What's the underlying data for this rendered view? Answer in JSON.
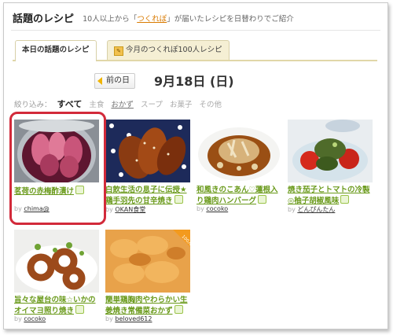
{
  "header": {
    "title": "話題のレシピ",
    "subtitle_before": "10人以上から「",
    "subtitle_link": "つくれぽ",
    "subtitle_after": "」が届いたレシピを日替わりでご紹介"
  },
  "tabs": [
    {
      "label": "本日の話題のレシピ",
      "active": true
    },
    {
      "label": "今月のつくれぽ100人レシピ",
      "active": false,
      "icon": "report-badge-icon"
    }
  ],
  "date_nav": {
    "prev_label": "前の日",
    "date": "9月18日 (日)"
  },
  "filter": {
    "label": "絞り込み：",
    "options": [
      "すべて",
      "主食",
      "おかず",
      "スープ",
      "お菓子",
      "その他"
    ],
    "selected": "すべて"
  },
  "recipes": [
    {
      "title": "茗荷の赤梅酢漬け",
      "by": "by",
      "author": "chima@"
    },
    {
      "title": "白飲生活の息子に伝授★鶏手羽先の甘辛焼き",
      "by": "by",
      "author": "OKAN食堂"
    },
    {
      "title": "和風きのこあん♡蓮根入り鶏肉ハンバーグ",
      "by": "by",
      "author": "cocoko"
    },
    {
      "title": "焼き茄子とトマトの冷製◎柚子胡椒風味",
      "by": "by",
      "author": "どんぴんたん"
    },
    {
      "title": "旨々な屋台の味☆いかのオイマヨ照り焼き",
      "by": "by",
      "author": "cocoko"
    },
    {
      "title": "簡単鶏胸肉やわらかい生姜焼き常備菜おかず",
      "by": "by",
      "author": "beloved612"
    }
  ],
  "badge": "100人",
  "colors": {
    "accent_green": "#6a9a1b",
    "highlight_red": "#d22a3a",
    "tab_border": "#d8d0a8"
  }
}
